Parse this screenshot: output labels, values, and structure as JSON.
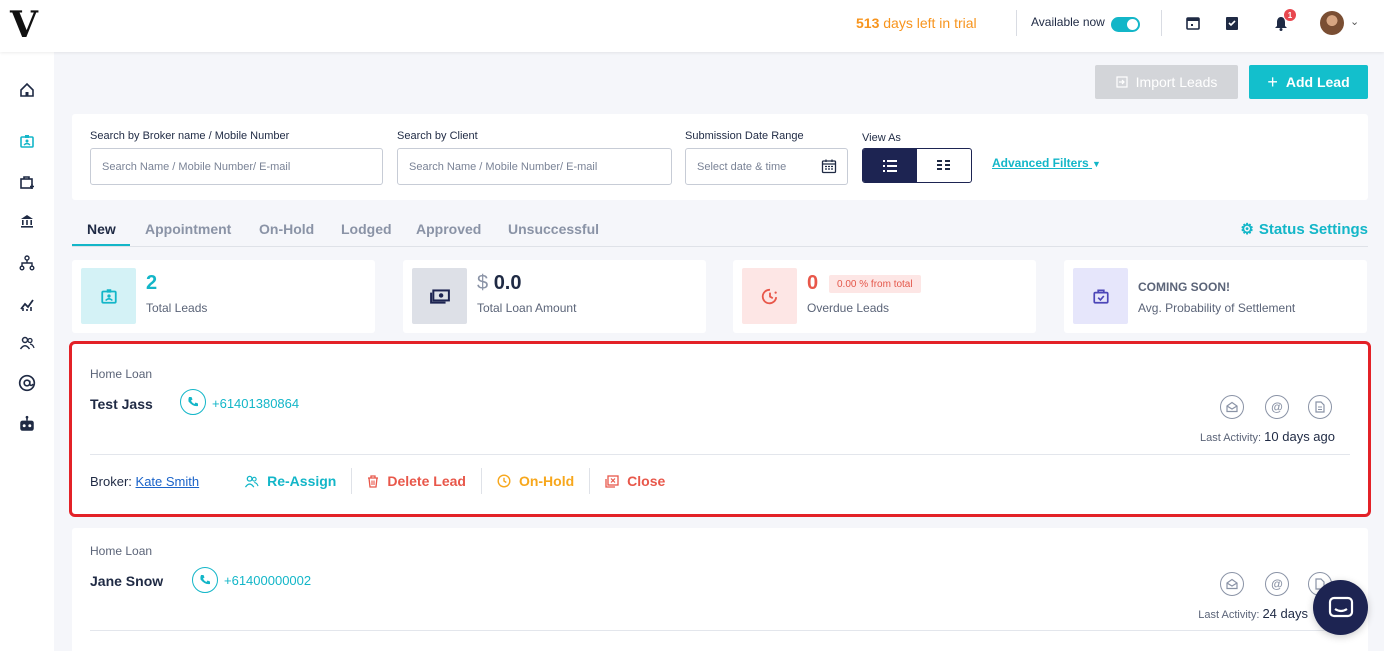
{
  "header": {
    "logo": "V",
    "trial_days": "513",
    "trial_text": "days left in trial",
    "availability_label": "Available now",
    "notification_count": "1"
  },
  "actions": {
    "import_label": "Import Leads",
    "add_label": "Add Lead"
  },
  "filters": {
    "broker_label": "Search by Broker name / Mobile Number",
    "broker_placeholder": "Search Name / Mobile Number/ E-mail",
    "client_label": "Search by Client",
    "client_placeholder": "Search Name / Mobile Number/ E-mail",
    "date_label": "Submission Date Range",
    "date_placeholder": "Select date & time",
    "view_label": "View As",
    "advanced_label": "Advanced Filters"
  },
  "tabs": [
    {
      "label": "New"
    },
    {
      "label": "Appointment"
    },
    {
      "label": "On-Hold"
    },
    {
      "label": "Lodged"
    },
    {
      "label": "Approved"
    },
    {
      "label": "Unsuccessful"
    }
  ],
  "status_settings_label": "Status Settings",
  "stats": [
    {
      "value": "2",
      "label": "Total Leads"
    },
    {
      "currency": "$",
      "value": "0.0",
      "label": "Total Loan Amount"
    },
    {
      "value": "0",
      "badge": "0.00 % from total",
      "label": "Overdue Leads"
    },
    {
      "value": "COMING SOON!",
      "label": "Avg. Probability of Settlement"
    }
  ],
  "leads": [
    {
      "type": "Home Loan",
      "name": "Test Jass",
      "phone": "+61401380864",
      "last_activity_label": "Last Activity:",
      "last_activity": "10 days ago",
      "broker_label": "Broker:",
      "broker": "Kate Smith",
      "reassign_label": "Re-Assign",
      "delete_label": "Delete Lead",
      "onhold_label": "On-Hold",
      "close_label": "Close"
    },
    {
      "type": "Home Loan",
      "name": "Jane Snow",
      "phone": "+61400000002",
      "last_activity_label": "Last Activity:",
      "last_activity": "24 days"
    }
  ],
  "colors": {
    "accent": "#13b6c8",
    "navy": "#1d2452",
    "danger": "#e8574a",
    "warning": "#f7a71c",
    "trial": "#f7941d"
  }
}
